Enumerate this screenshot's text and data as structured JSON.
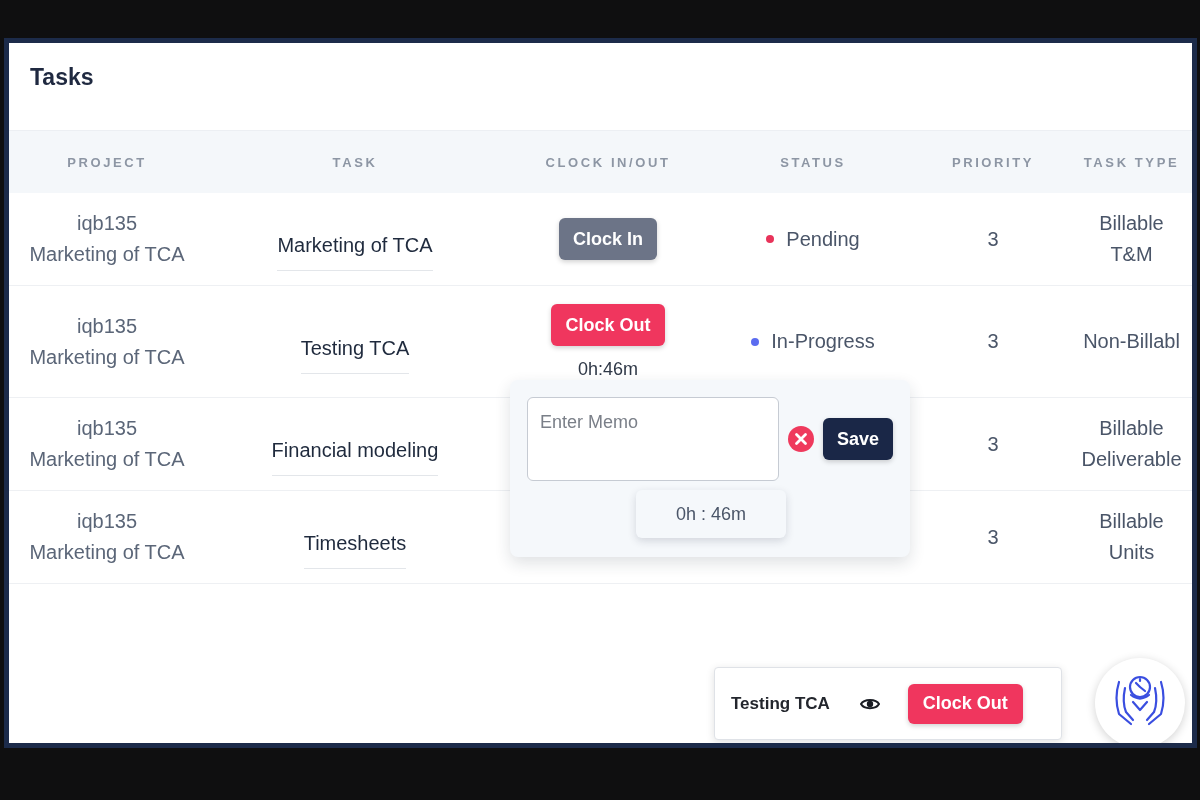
{
  "page": {
    "title": "Tasks"
  },
  "table": {
    "columns": [
      "PROJECT",
      "TASK",
      "CLOCK IN/OUT",
      "STATUS",
      "PRIORITY",
      "TASK TYPE"
    ],
    "rows": [
      {
        "project_code": "iqb135",
        "project_name": "Marketing of TCA",
        "task": "Marketing of TCA",
        "clock": {
          "kind": "clock-in",
          "label": "Clock In"
        },
        "status": {
          "label": "Pending",
          "color": "#e8335a"
        },
        "priority": "3",
        "task_type": "Billable T&M"
      },
      {
        "project_code": "iqb135",
        "project_name": "Marketing of TCA",
        "task": "Testing TCA",
        "clock": {
          "kind": "clock-out",
          "label": "Clock Out",
          "elapsed": "0h:46m"
        },
        "status": {
          "label": "In-Progress",
          "color": "#5b6cf0"
        },
        "priority": "3",
        "task_type": "Non-Billabl"
      },
      {
        "project_code": "iqb135",
        "project_name": "Marketing of TCA",
        "task": "Financial modeling",
        "priority": "3",
        "task_type": "Billable Deliverable"
      },
      {
        "project_code": "iqb135",
        "project_name": "Marketing of TCA",
        "task": "Timesheets",
        "priority": "3",
        "task_type": "Billable Units"
      }
    ]
  },
  "memo_popover": {
    "placeholder": "Enter Memo",
    "save_label": "Save",
    "elapsed": "0h : 46m"
  },
  "active_task_bar": {
    "task": "Testing TCA",
    "button": "Clock Out"
  }
}
